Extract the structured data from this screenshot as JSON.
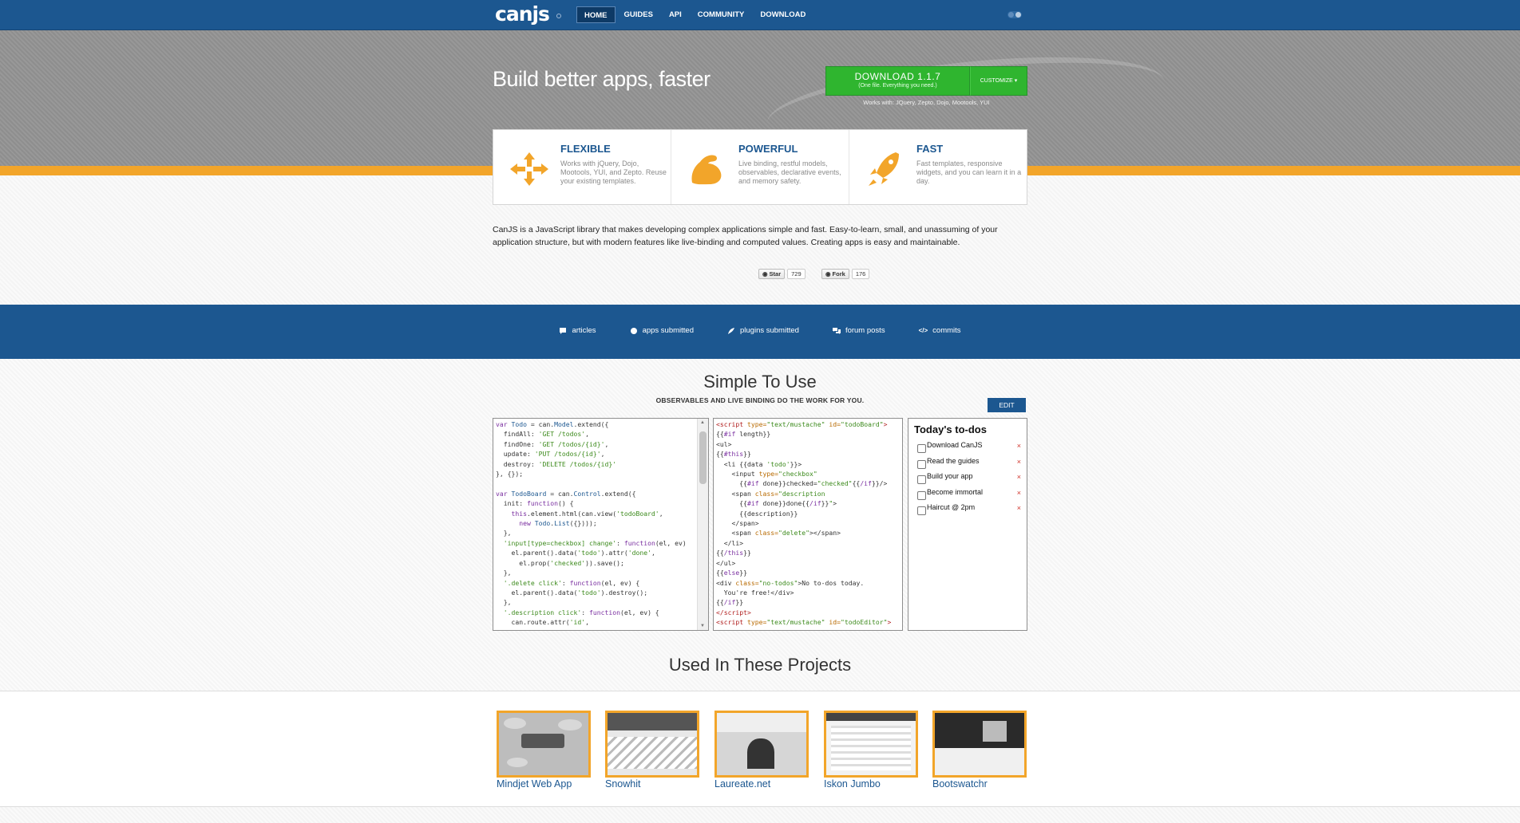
{
  "nav": {
    "logo": "canjs",
    "items": [
      "HOME",
      "GUIDES",
      "API",
      "COMMUNITY",
      "DOWNLOAD"
    ]
  },
  "hero": {
    "tagline": "Build better apps, faster",
    "download_label": "DOWNLOAD 1.1.7",
    "download_sub": "(One file. Everything you need.)",
    "customize_label": "CUSTOMIZE ▾",
    "works_with": "Works with: JQuery, Zepto, Dojo, Mootools, YUI"
  },
  "features": [
    {
      "title": "FLEXIBLE",
      "icon": "arrows-icon",
      "desc": "Works with jQuery, Dojo, Mootools, YUI, and Zepto. Reuse your existing templates."
    },
    {
      "title": "POWERFUL",
      "icon": "flexed-arm-icon",
      "desc": "Live binding, restful models, observables, declarative events, and memory safety."
    },
    {
      "title": "FAST",
      "icon": "rocket-icon",
      "desc": "Fast templates, responsive widgets, and you can learn it in a day."
    }
  ],
  "intro": "CanJS is a JavaScript library that makes developing complex applications simple and fast. Easy-to-learn, small, and unassuming of your application structure, but with modern features like live-binding and computed values. Creating apps is easy and maintainable.",
  "github": {
    "star_label": "Star",
    "star_count": "729",
    "fork_label": "Fork",
    "fork_count": "176"
  },
  "stats": [
    "articles",
    "apps submitted",
    "plugins submitted",
    "forum posts",
    "commits"
  ],
  "simple": {
    "title": "Simple To Use",
    "subtitle": "OBSERVABLES AND LIVE BINDING DO THE WORK FOR YOU.",
    "edit_label": "EDIT"
  },
  "todos": {
    "title": "Today's to-dos",
    "items": [
      "Download CanJS",
      "Read the guides",
      "Build your app",
      "Become immortal",
      "Haircut @ 2pm"
    ],
    "delete_glyph": "×"
  },
  "projects": {
    "title": "Used In These Projects",
    "items": [
      "Mindjet Web App",
      "Snowhit",
      "Laureate.net",
      "Iskon Jumbo",
      "Bootswatchr"
    ]
  },
  "colors": {
    "brand_blue": "#1c5790",
    "accent_orange": "#f2a52a",
    "download_green": "#2fb52f"
  }
}
